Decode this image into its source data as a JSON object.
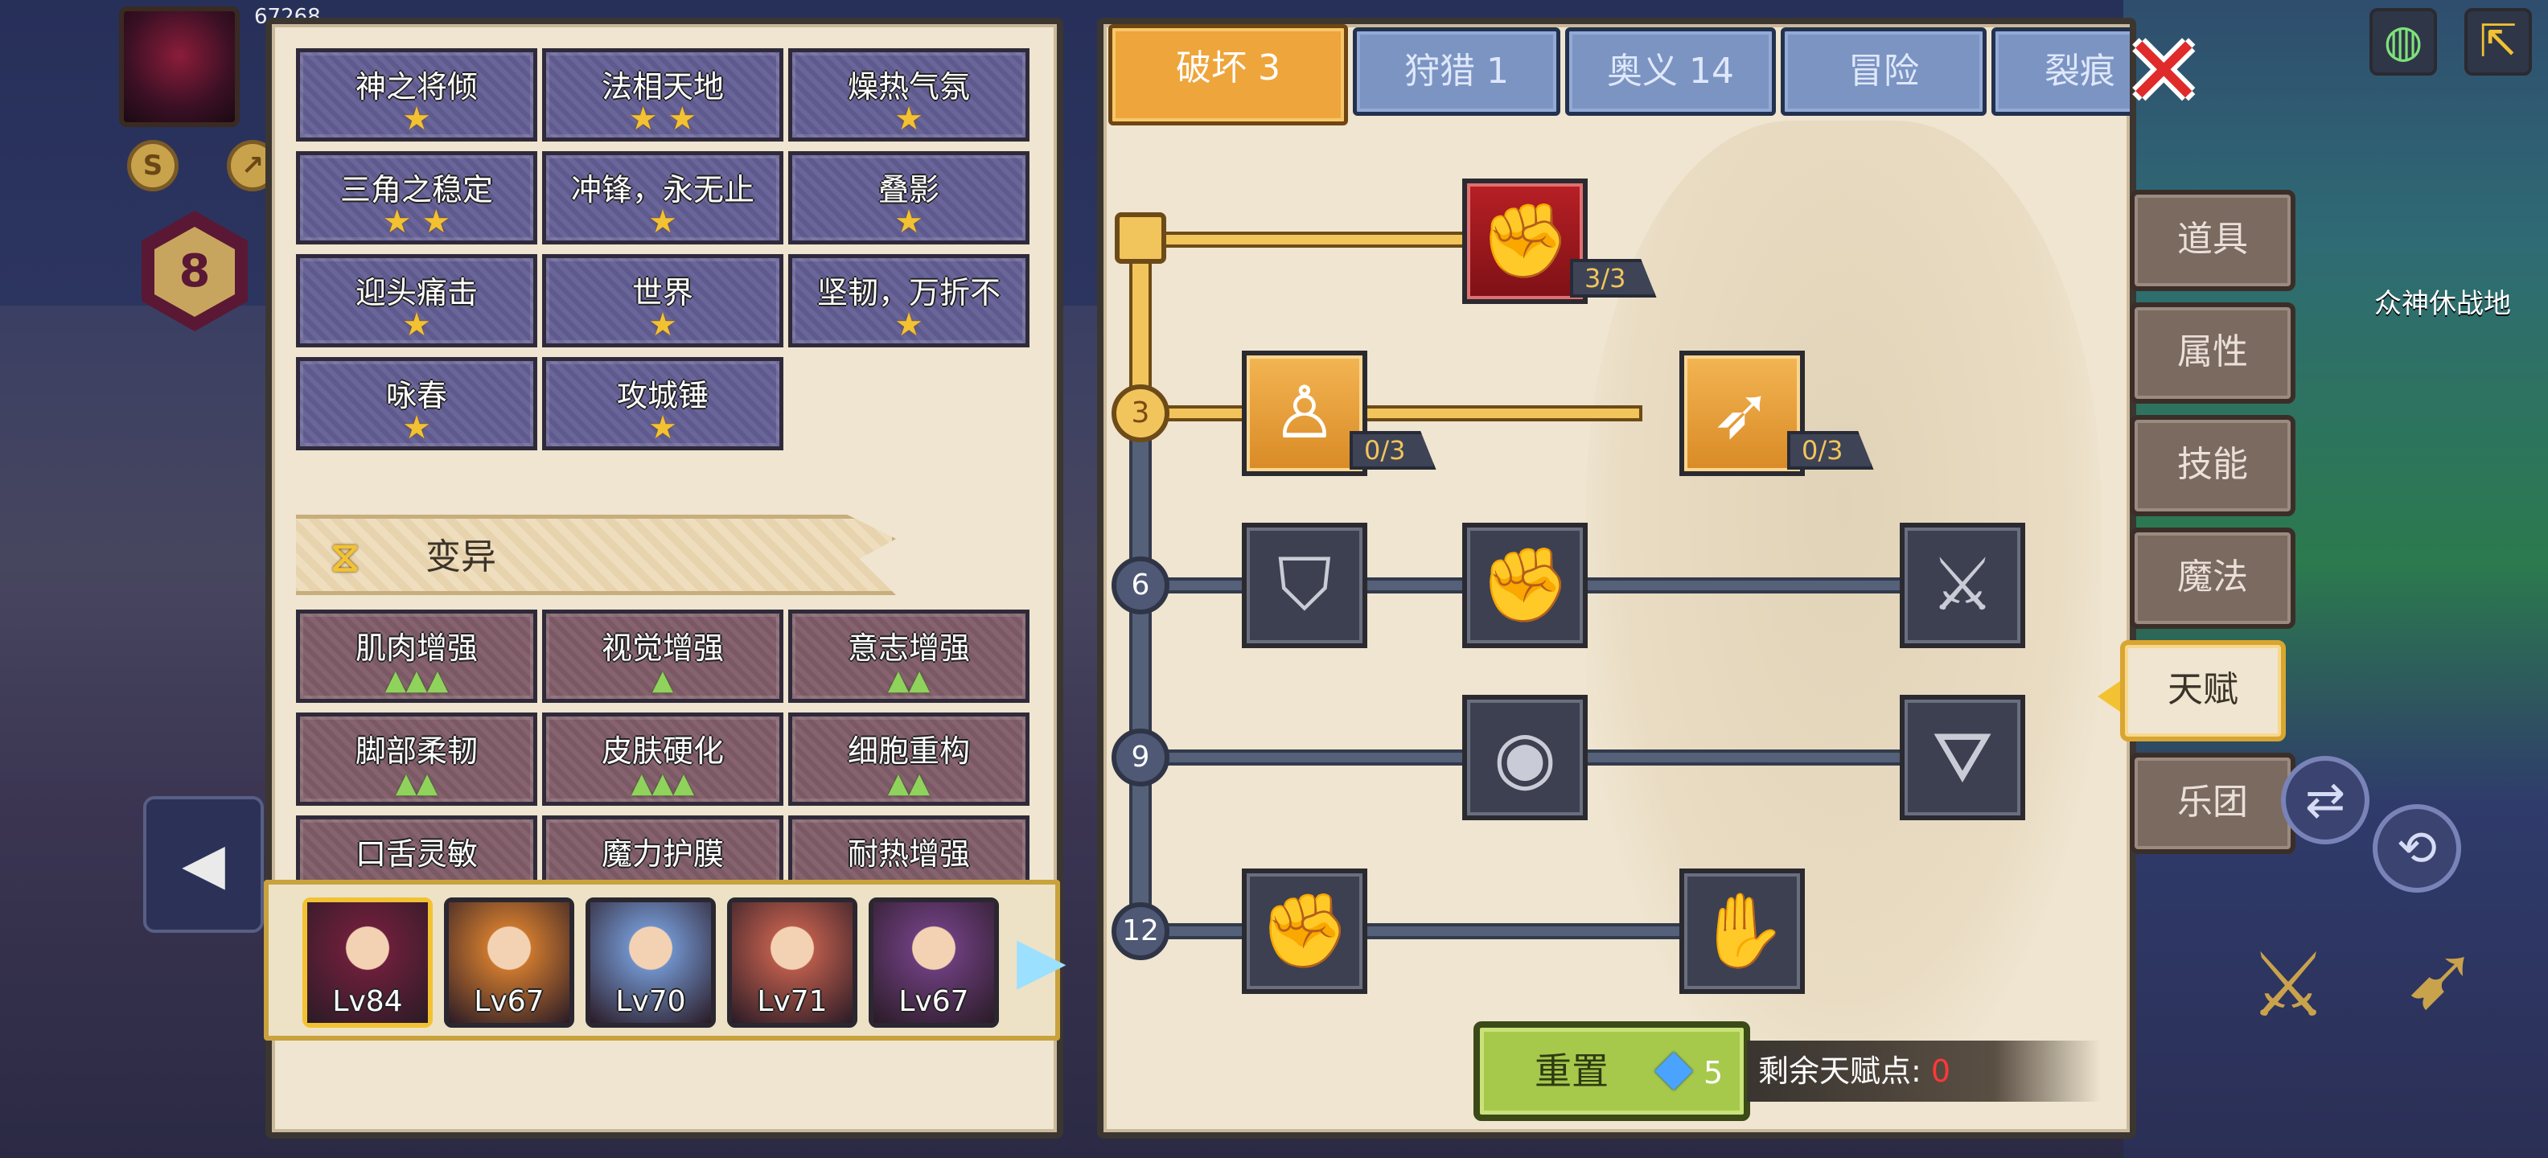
{
  "hud": {
    "level": "8",
    "hp_text": "67268"
  },
  "left": {
    "star_talents": [
      {
        "name": "神之将倾",
        "stars": "★"
      },
      {
        "name": "法相天地",
        "stars": "★ ★"
      },
      {
        "name": "燥热气氛",
        "stars": "★"
      },
      {
        "name": "三角之稳定",
        "stars": "★ ★"
      },
      {
        "name": "冲锋，永无止",
        "stars": "★"
      },
      {
        "name": "叠影",
        "stars": "★"
      },
      {
        "name": "迎头痛击",
        "stars": "★"
      },
      {
        "name": "世界",
        "stars": "★"
      },
      {
        "name": "坚韧，万折不",
        "stars": "★"
      },
      {
        "name": "咏春",
        "stars": "★"
      },
      {
        "name": "攻城锤",
        "stars": "★"
      }
    ],
    "section_title": "变异",
    "mutations": [
      {
        "name": "肌肉增强",
        "marks": "▲▲▲"
      },
      {
        "name": "视觉增强",
        "marks": "▲"
      },
      {
        "name": "意志增强",
        "marks": "▲▲"
      },
      {
        "name": "脚部柔韧",
        "marks": "▲▲"
      },
      {
        "name": "皮肤硬化",
        "marks": "▲▲▲"
      },
      {
        "name": "细胞重构",
        "marks": "▲▲"
      },
      {
        "name": "口舌灵敏",
        "marks": ""
      },
      {
        "name": "魔力护膜",
        "marks": ""
      },
      {
        "name": "耐热增强",
        "marks": ""
      }
    ],
    "heroes": [
      {
        "level": "Lv84",
        "selected": true,
        "color": "#6b1f3a"
      },
      {
        "level": "Lv67",
        "selected": false,
        "color": "#c9772e"
      },
      {
        "level": "Lv70",
        "selected": false,
        "color": "#6f8fc6"
      },
      {
        "level": "Lv71",
        "selected": false,
        "color": "#b55a4a"
      },
      {
        "level": "Lv67",
        "selected": false,
        "color": "#6a3d7a"
      }
    ]
  },
  "tabs": [
    {
      "label": "破坏 3",
      "active": true
    },
    {
      "label": "狩猎 1",
      "active": false
    },
    {
      "label": "奥义 14",
      "active": false
    },
    {
      "label": "冒险",
      "active": false
    },
    {
      "label": "裂痕",
      "active": false
    }
  ],
  "tree": {
    "tiers": [
      "3",
      "6",
      "9",
      "12"
    ],
    "skills": {
      "top": {
        "count": "3/3",
        "icon": "arm-wrestle-icon"
      },
      "r3a": {
        "count": "0/3",
        "icon": "muscle-body-icon"
      },
      "r3b": {
        "count": "0/3",
        "icon": "arrow-strike-icon"
      },
      "r6a": {
        "icon": "shield-break-icon"
      },
      "r6b": {
        "icon": "punch-icon"
      },
      "r6c": {
        "icon": "splash-strike-icon"
      },
      "r9a": {
        "icon": "shockwave-icon"
      },
      "r9b": {
        "icon": "bat-wing-icon"
      },
      "r12a": {
        "icon": "raised-fist-icon"
      },
      "r12b": {
        "icon": "gauntlet-icon"
      }
    },
    "reset_label": "重置",
    "reset_cost": "5",
    "points_label": "剩余天赋点:",
    "points_value": "0"
  },
  "side_tabs": [
    {
      "label": "道具",
      "active": false
    },
    {
      "label": "属性",
      "active": false
    },
    {
      "label": "技能",
      "active": false
    },
    {
      "label": "魔法",
      "active": false
    },
    {
      "label": "天赋",
      "active": true
    },
    {
      "label": "乐团",
      "active": false
    }
  ],
  "map_label": "众神休战地",
  "colors": {
    "accent": "#eea53b",
    "gold": "#f2c232",
    "close": "#e02b2b",
    "points_zero": "#ff3838"
  }
}
